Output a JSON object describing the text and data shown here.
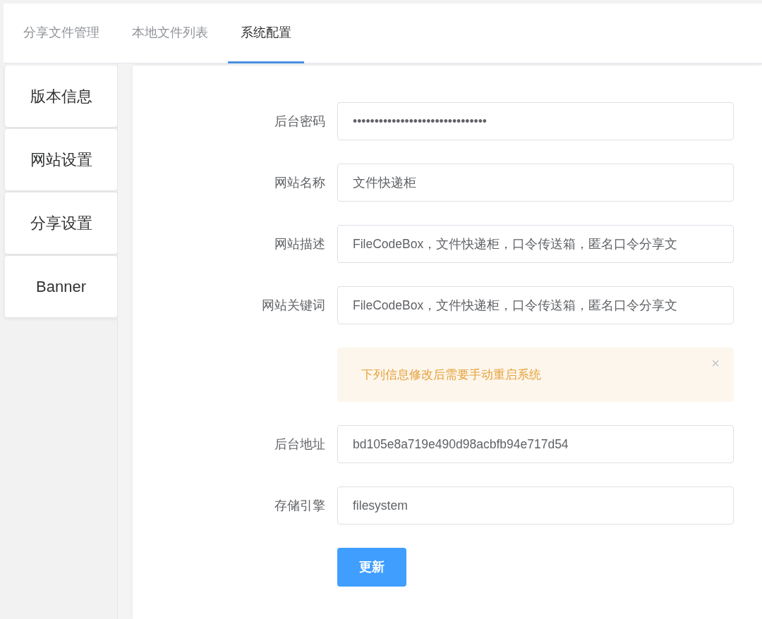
{
  "tabs": [
    {
      "label": "分享文件管理",
      "selected": false
    },
    {
      "label": "本地文件列表",
      "selected": false
    },
    {
      "label": "系统配置",
      "selected": true
    }
  ],
  "sidebar": {
    "items": [
      {
        "label": "版本信息"
      },
      {
        "label": "网站设置"
      },
      {
        "label": "分享设置"
      },
      {
        "label": "Banner"
      }
    ]
  },
  "form": {
    "fields": [
      {
        "kind": "field",
        "label": "后台密码",
        "value": "•••••••••••••••••••••••••••••••"
      },
      {
        "kind": "field",
        "label": "网站名称",
        "value": "文件快递柜"
      },
      {
        "kind": "field",
        "label": "网站描述",
        "value": "FileCodeBox，文件快递柜，口令传送箱，匿名口令分享文"
      },
      {
        "kind": "field",
        "label": "网站关键词",
        "value": "FileCodeBox，文件快递柜，口令传送箱，匿名口令分享文"
      },
      {
        "kind": "alert",
        "text": "下列信息修改后需要手动重启系统",
        "close": "×"
      },
      {
        "kind": "field",
        "label": "后台地址",
        "value": "bd105e8a719e490d98acbfb94e717d54"
      },
      {
        "kind": "field",
        "label": "存储引擎",
        "value": "filesystem"
      }
    ],
    "submit": "更新"
  }
}
